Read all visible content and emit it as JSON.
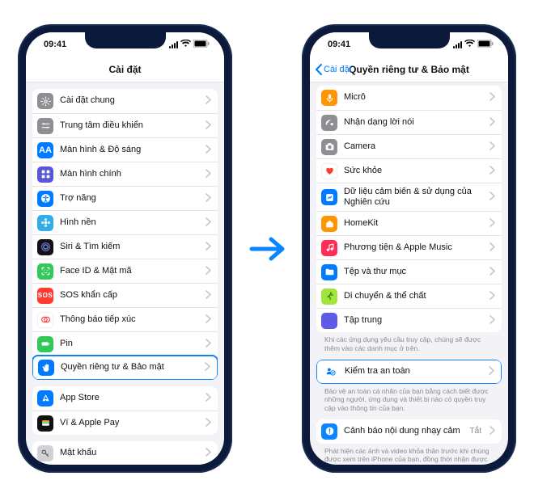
{
  "statusbar": {
    "time": "09:41"
  },
  "phoneA": {
    "title": "Cài đặt",
    "group1": [
      {
        "label": "Cài đặt chung",
        "icon": "gear",
        "bg": "c-gray"
      },
      {
        "label": "Trung tâm điều khiển",
        "icon": "sliders",
        "bg": "c-gray2"
      },
      {
        "label": "Màn hình & Độ sáng",
        "icon": "brightness",
        "bg": "c-blue"
      },
      {
        "label": "Màn hình chính",
        "icon": "grid",
        "bg": "c-indigo"
      },
      {
        "label": "Trợ năng",
        "icon": "accessibility",
        "bg": "c-blue"
      },
      {
        "label": "Hình nền",
        "icon": "flower",
        "bg": "c-cyan"
      },
      {
        "label": "Siri & Tìm kiếm",
        "icon": "siri",
        "bg": "c-black"
      },
      {
        "label": "Face ID & Mật mã",
        "icon": "faceid",
        "bg": "c-green"
      },
      {
        "label": "SOS khẩn cấp",
        "icon": "sos",
        "bg": "c-red"
      },
      {
        "label": "Thông báo tiếp xúc",
        "icon": "exposure",
        "bg": "c-white"
      },
      {
        "label": "Pin",
        "icon": "battery",
        "bg": "c-green"
      },
      {
        "label": "Quyền riêng tư & Bảo mật",
        "icon": "hand",
        "bg": "c-blue",
        "hl": true
      }
    ],
    "group2": [
      {
        "label": "App Store",
        "icon": "appstore",
        "bg": "c-blue"
      },
      {
        "label": "Ví & Apple Pay",
        "icon": "wallet",
        "bg": "c-black"
      }
    ],
    "group3": [
      {
        "label": "Mật khẩu",
        "icon": "key",
        "bg": "c-lgray"
      }
    ]
  },
  "phoneB": {
    "backLabel": "Cài đặt",
    "title": "Quyền riêng tư & Bảo mật",
    "group1": [
      {
        "label": "Micrô",
        "icon": "mic",
        "bg": "c-orange"
      },
      {
        "label": "Nhận dạng lời nói",
        "icon": "speech",
        "bg": "c-gray"
      },
      {
        "label": "Camera",
        "icon": "camera",
        "bg": "c-gray"
      },
      {
        "label": "Sức khỏe",
        "icon": "heart",
        "bg": "c-white"
      },
      {
        "label": "Dữ liệu cảm biến & sử dụng của Nghiên cứu",
        "icon": "research",
        "bg": "c-blue"
      },
      {
        "label": "HomeKit",
        "icon": "home",
        "bg": "c-orange"
      },
      {
        "label": "Phương tiện & Apple Music",
        "icon": "music",
        "bg": "c-mag"
      },
      {
        "label": "Tệp và thư mục",
        "icon": "folder",
        "bg": "c-blue"
      },
      {
        "label": "Di chuyển & thể chất",
        "icon": "run",
        "bg": "c-lime"
      },
      {
        "label": "Tập trung",
        "icon": "moon",
        "bg": "c-purple"
      }
    ],
    "note1": "Khi các ứng dụng yêu cầu truy cập, chúng sẽ được thêm vào các danh mục ở trên.",
    "group2": [
      {
        "label": "Kiểm tra an toàn",
        "icon": "safety",
        "bg": "",
        "hl": true
      }
    ],
    "note2": "Bảo vệ an toàn cá nhân của bạn bằng cách biết được những người, ứng dụng và thiết bị nào có quyền truy cập vào thông tin của bạn.",
    "group3": [
      {
        "label": "Cảnh báo nội dung nhạy cảm",
        "icon": "warn",
        "bg": "c-blue2",
        "trail": "Tắt"
      }
    ],
    "note3": "Phát hiện các ảnh và video khỏa thân trước khi chúng được xem trên iPhone của bạn, đồng thời nhận được"
  }
}
